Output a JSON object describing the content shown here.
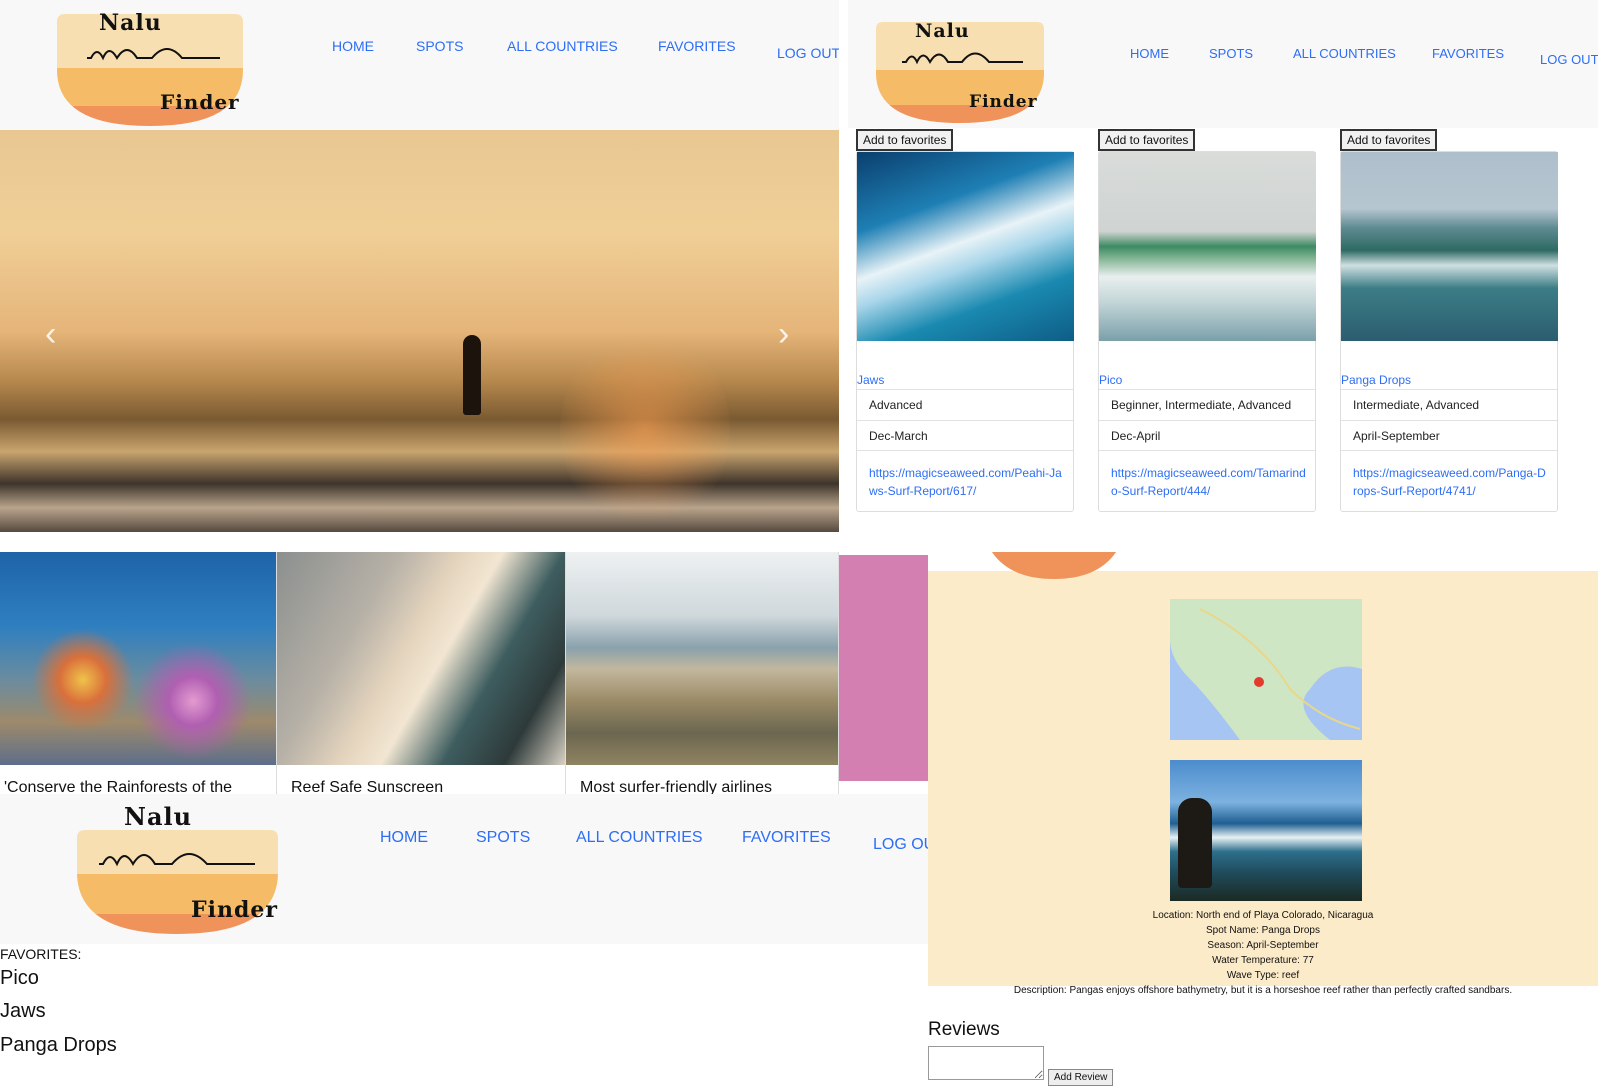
{
  "brand": {
    "word1": "Nalu",
    "word2": "Finder"
  },
  "nav": {
    "home": "HOME",
    "spots": "SPOTS",
    "all_countries": "ALL COUNTRIES",
    "favorites": "FAVORITES",
    "logout": "LOG OUT",
    "logout_cut": "LOG OU"
  },
  "hero": {
    "prev_icon": "chevron-left-icon",
    "next_icon": "chevron-right-icon",
    "prev": "‹",
    "next": "›"
  },
  "spots": {
    "add_label": "Add to favorites",
    "cards": [
      {
        "name": "Jaws",
        "level": "Advanced",
        "season": "Dec-March",
        "link": "https://magicseaweed.com/Peahi-Jaws-Surf-Report/617/"
      },
      {
        "name": "Pico",
        "level": "Beginner, Intermediate, Advanced",
        "season": "Dec-April",
        "link": "https://magicseaweed.com/Tamarindo-Surf-Report/444/"
      },
      {
        "name": "Panga Drops",
        "level": "Intermediate, Advanced",
        "season": "April-September",
        "link": "https://magicseaweed.com/Panga-Drops-Surf-Report/4741/"
      }
    ]
  },
  "articles": [
    {
      "title": "'Conserve the Rainforests of the"
    },
    {
      "title": "Reef Safe Sunscreen"
    },
    {
      "title": "Most surfer-friendly airlines"
    }
  ],
  "favorites": {
    "heading": "FAVORITES:",
    "items": [
      "Pico",
      "Jaws",
      "Panga Drops"
    ]
  },
  "detail": {
    "location": "Location: North end of Playa Colorado, Nicaragua",
    "spot_name": "Spot Name: Panga Drops",
    "season": "Season: April-September",
    "water_temp": "Water Temperature: 77",
    "wave_type": "Wave Type: reef",
    "description": "Description: Pangas enjoys offshore bathymetry, but it is a horseshoe reef rather than perfectly crafted sandbars.",
    "reviews_label": "Reviews",
    "add_review": "Add Review"
  },
  "colors": {
    "link": "#2d6ef5",
    "cream": "#fcebc9",
    "pink": "#d37fb1",
    "logo_top": "#f8dfb1",
    "logo_mid": "#f5bb66",
    "logo_bottom": "#f0935a"
  }
}
